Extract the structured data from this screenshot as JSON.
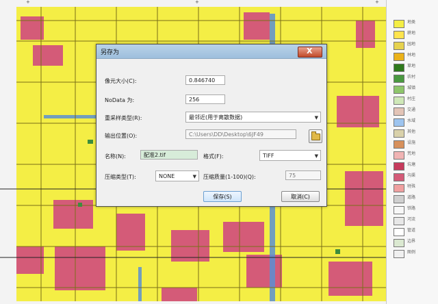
{
  "dialog": {
    "title": "另存为",
    "close_label": "X",
    "cell_size_label": "像元大小(C):",
    "cell_size_value": "0.846740",
    "nodata_label": "NoData 为:",
    "nodata_value": "256",
    "resample_label": "重采样类型(R):",
    "resample_value": "最邻近(用于离散数据)",
    "output_location_label": "输出位置(O):",
    "output_location_value": "C:\\Users\\DD\\Desktop\\6JF49",
    "name_label": "名称(N):",
    "name_value": "配准2.tif",
    "format_label": "格式(F):",
    "format_value": "TIFF",
    "compression_type_label": "压缩类型(T):",
    "compression_type_value": "NONE",
    "compression_quality_label": "压缩质量(1-100)(Q):",
    "compression_quality_value": "75",
    "save_button": "保存(S)",
    "cancel_button": "取消(C)"
  },
  "map": {
    "top_marks": [
      "+",
      "+",
      "+"
    ],
    "legend_labels": [
      "地类",
      "耕地",
      "园地",
      "林地",
      "草地",
      "农村",
      "城镇",
      "村庄",
      "交通",
      "水域",
      "其他",
      "设施",
      "荒地",
      "坑塘",
      "沟渠",
      "特殊",
      "道路",
      "铁路",
      "河流",
      "管道",
      "边界",
      "图例"
    ]
  },
  "colors": {
    "map_yellow": "#f4ee45",
    "urban_pink": "#d45b78",
    "water_blue": "#5a8fd2",
    "road_line": "#7a6f18",
    "legend_bg": "#f7f7f7"
  }
}
